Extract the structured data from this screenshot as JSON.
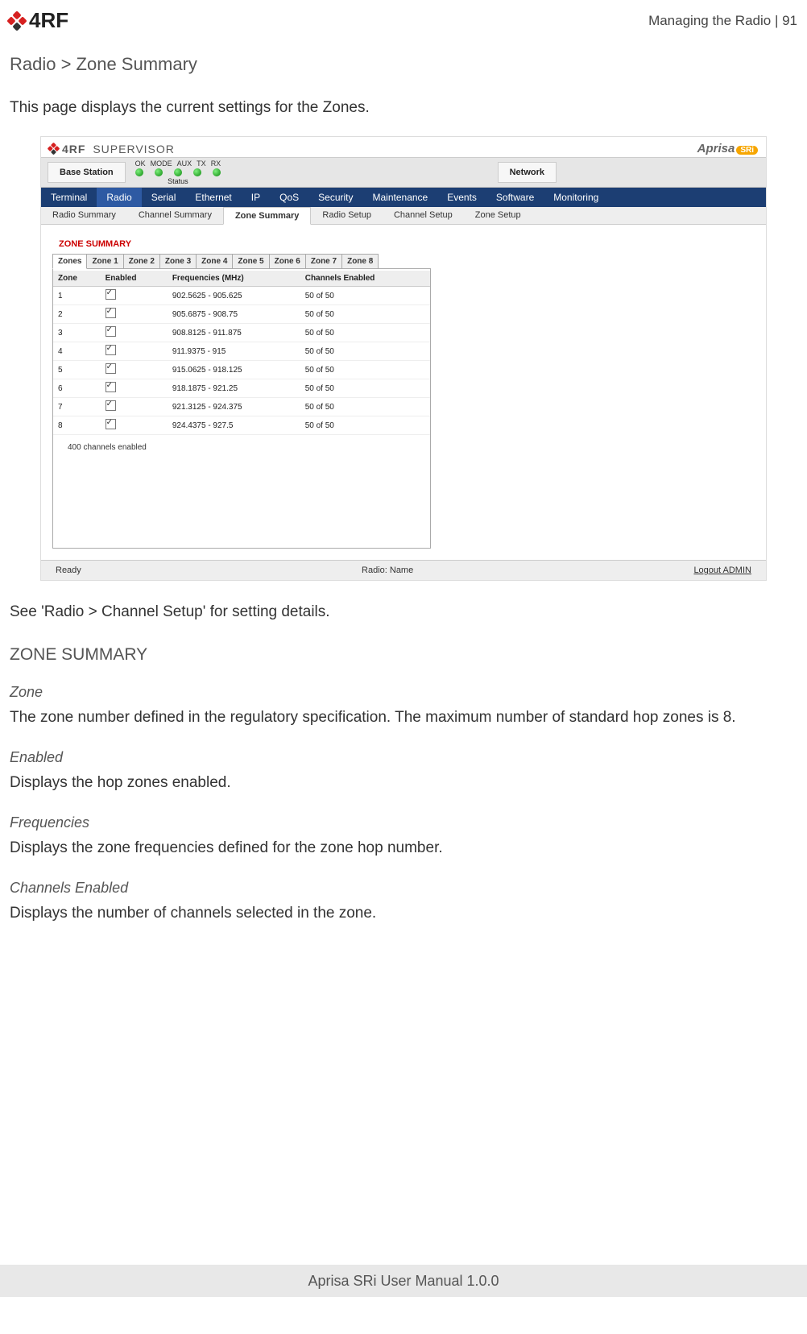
{
  "header": {
    "logo_text": "4RF",
    "right": "Managing the Radio  |  91"
  },
  "breadcrumb": "Radio > Zone Summary",
  "intro": "This page displays the current settings for the Zones.",
  "shot": {
    "supervisor": "SUPERVISOR",
    "aprisa": "Aprisa",
    "aprisa_sri": "SRi",
    "base_station": "Base Station",
    "led_labels": [
      "OK",
      "MODE",
      "AUX",
      "TX",
      "RX"
    ],
    "status_label": "Status",
    "network": "Network",
    "main_nav": [
      "Terminal",
      "Radio",
      "Serial",
      "Ethernet",
      "IP",
      "QoS",
      "Security",
      "Maintenance",
      "Events",
      "Software",
      "Monitoring"
    ],
    "main_nav_active": 1,
    "sub_nav": [
      "Radio Summary",
      "Channel Summary",
      "Zone Summary",
      "Radio Setup",
      "Channel Setup",
      "Zone Setup"
    ],
    "sub_nav_active": 2,
    "panel_title": "ZONE SUMMARY",
    "zone_tabs": [
      "Zones",
      "Zone 1",
      "Zone 2",
      "Zone 3",
      "Zone 4",
      "Zone 5",
      "Zone 6",
      "Zone 7",
      "Zone 8"
    ],
    "zone_tabs_active": 0,
    "table_headers": [
      "Zone",
      "Enabled",
      "Frequencies (MHz)",
      "Channels Enabled"
    ],
    "rows": [
      {
        "zone": "1",
        "enabled": true,
        "freq": "902.5625 - 905.625",
        "ch": "50 of 50"
      },
      {
        "zone": "2",
        "enabled": true,
        "freq": "905.6875 - 908.75",
        "ch": "50 of 50"
      },
      {
        "zone": "3",
        "enabled": true,
        "freq": "908.8125 - 911.875",
        "ch": "50 of 50"
      },
      {
        "zone": "4",
        "enabled": true,
        "freq": "911.9375 - 915",
        "ch": "50 of 50"
      },
      {
        "zone": "5",
        "enabled": true,
        "freq": "915.0625 - 918.125",
        "ch": "50 of 50"
      },
      {
        "zone": "6",
        "enabled": true,
        "freq": "918.1875 - 921.25",
        "ch": "50 of 50"
      },
      {
        "zone": "7",
        "enabled": true,
        "freq": "921.3125 - 924.375",
        "ch": "50 of 50"
      },
      {
        "zone": "8",
        "enabled": true,
        "freq": "924.4375 - 927.5",
        "ch": "50 of 50"
      }
    ],
    "total_note": "400 channels enabled",
    "footer_ready": "Ready",
    "footer_radio": "Radio: Name",
    "footer_logout": "Logout ADMIN"
  },
  "see_text_pre": "See '",
  "see_link": "Radio > Channel Setup",
  "see_text_post": "' for setting details.",
  "section_title": "ZONE SUMMARY",
  "fields": [
    {
      "h": "Zone",
      "d": "The zone number defined in the regulatory specification. The maximum number of standard hop zones is 8."
    },
    {
      "h": "Enabled",
      "d": "Displays the hop zones enabled."
    },
    {
      "h": "Frequencies",
      "d": "Displays the zone frequencies defined for the zone hop number."
    },
    {
      "h": "Channels Enabled",
      "d": "Displays the number of channels selected in the zone."
    }
  ],
  "footer": "Aprisa SRi User Manual 1.0.0"
}
